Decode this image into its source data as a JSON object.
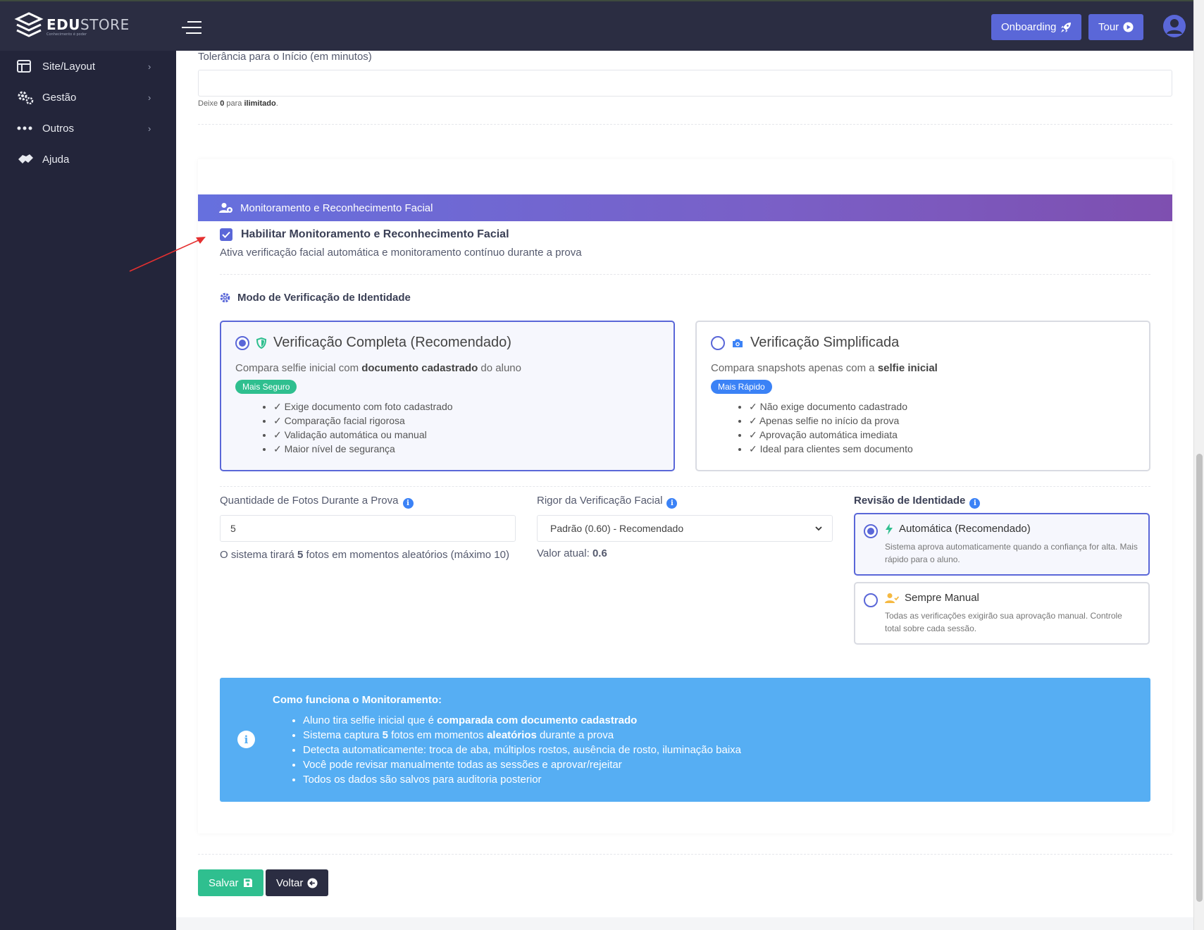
{
  "brand": {
    "name_bold": "EDU",
    "name_light": "STORE",
    "tagline": "Conhecimento é poder"
  },
  "header": {
    "onboarding_label": "Onboarding",
    "tour_label": "Tour"
  },
  "sidebar": {
    "items": [
      {
        "label": "Site/Layout",
        "icon": "layout-icon"
      },
      {
        "label": "Gestão",
        "icon": "gears-icon"
      },
      {
        "label": "Outros",
        "icon": "dots-icon"
      },
      {
        "label": "Ajuda",
        "icon": "handshake-icon"
      }
    ]
  },
  "tolerance": {
    "label": "Tolerância para o Início (em minutos)",
    "value": "",
    "help_prefix": "Deixe ",
    "help_zero": "0",
    "help_mid": " para ",
    "help_unlimited": "ilimitado",
    "help_suffix": "."
  },
  "facial": {
    "section_title": "Monitoramento e Reconhecimento Facial",
    "enable_label": "Habilitar Monitoramento e Reconhecimento Facial",
    "enable_checked": true,
    "enable_desc": "Ativa verificação facial automática e monitoramento contínuo durante a prova",
    "mode_title": "Modo de Verificação de Identidade",
    "modes": [
      {
        "title": "Verificação Completa (Recomendado)",
        "desc_prefix": "Compara selfie inicial com ",
        "desc_bold": "documento cadastrado",
        "desc_suffix": " do aluno",
        "badge": "Mais Seguro",
        "selected": true,
        "features": [
          "✓ Exige documento com foto cadastrado",
          "✓ Comparação facial rigorosa",
          "✓ Validação automática ou manual",
          "✓ Maior nível de segurança"
        ]
      },
      {
        "title": "Verificação Simplificada",
        "desc_prefix": "Compara snapshots apenas com a ",
        "desc_bold": "selfie inicial",
        "desc_suffix": "",
        "badge": "Mais Rápido",
        "selected": false,
        "features": [
          "✓ Não exige documento cadastrado",
          "✓ Apenas selfie no início da prova",
          "✓ Aprovação automática imediata",
          "✓ Ideal para clientes sem documento"
        ]
      }
    ],
    "photos": {
      "label": "Quantidade de Fotos Durante a Prova",
      "value": "5",
      "help_prefix": "O sistema tirará ",
      "help_bold": "5",
      "help_suffix": " fotos em momentos aleatórios (máximo 10)"
    },
    "rigor": {
      "label": "Rigor da Verificação Facial",
      "selected": "Padrão (0.60) - Recomendado",
      "current_prefix": "Valor atual: ",
      "current_value": "0.6"
    },
    "review": {
      "label": "Revisão de Identidade",
      "options": [
        {
          "title": "Automática (Recomendado)",
          "desc": "Sistema aprova automaticamente quando a confiança for alta. Mais rápido para o aluno.",
          "selected": true
        },
        {
          "title": "Sempre Manual",
          "desc": "Todas as verificações exigirão sua aprovação manual. Controle total sobre cada sessão.",
          "selected": false
        }
      ]
    },
    "how": {
      "title": "Como funciona o Monitoramento:",
      "l1_prefix": "Aluno tira selfie inicial que é ",
      "l1_bold": "comparada com documento cadastrado",
      "l2_prefix": "Sistema captura ",
      "l2_bold1": "5",
      "l2_mid": " fotos em momentos ",
      "l2_bold2": "aleatórios",
      "l2_suffix": " durante a prova",
      "l3": "Detecta automaticamente: troca de aba, múltiplos rostos, ausência de rosto, iluminação baixa",
      "l4": "Você pode revisar manualmente todas as sessões e aprovar/rejeitar",
      "l5": "Todos os dados são salvos para auditoria posterior"
    }
  },
  "actions": {
    "save_label": "Salvar",
    "back_label": "Voltar"
  },
  "colors": {
    "accent": "#5a67d8",
    "success": "#2fbf8f",
    "info": "#56aef3",
    "sidebar": "#23253a",
    "header": "#2b2d42"
  }
}
